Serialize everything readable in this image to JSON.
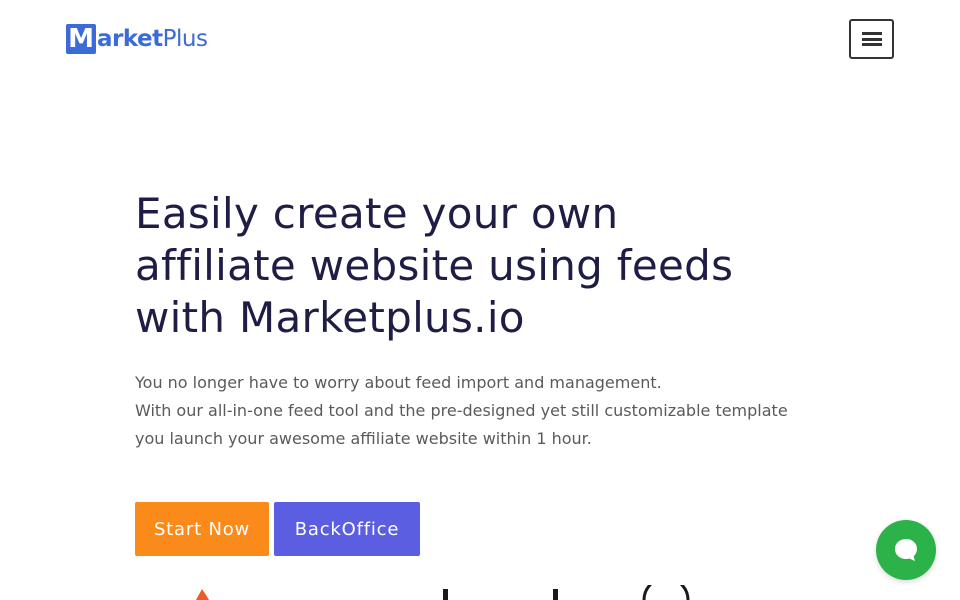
{
  "header": {
    "logo": {
      "m": "M",
      "market": "arket",
      "plus": "Plus",
      "color": "#3b6bd6"
    },
    "menu_icon": "hamburger-icon"
  },
  "hero": {
    "title_lines": [
      "Easily create your own",
      "affiliate website using feeds",
      "with Marketplus.io"
    ],
    "description_lines": [
      "You no longer have to worry about feed import and management.",
      "With our all-in-one feed tool and the pre-designed yet still customizable template",
      "you launch your awesome affiliate website within 1 hour."
    ],
    "buttons": {
      "start_label": "Start Now",
      "backoffice_label": "BackOffice"
    }
  },
  "colors": {
    "title": "#1f1d45",
    "start_button": "#fa8a1a",
    "backoffice_button": "#5b5ee0",
    "chat_button": "#2bb34a"
  },
  "chat": {
    "icon": "chat-bubble-icon"
  }
}
